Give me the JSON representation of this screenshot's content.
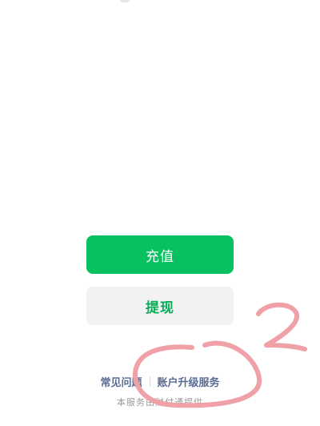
{
  "actions": {
    "recharge_label": "充值",
    "withdraw_label": "提现"
  },
  "footer": {
    "faq_label": "常见问题",
    "upgrade_label": "账户升级服务",
    "provider_text": "本服务由财付通提供"
  },
  "annotation": {
    "marker_text": "2",
    "color": "#f0a0a7"
  },
  "colors": {
    "primary_green": "#07c160",
    "link_blue": "#576b95",
    "secondary_bg": "#f2f2f2"
  }
}
